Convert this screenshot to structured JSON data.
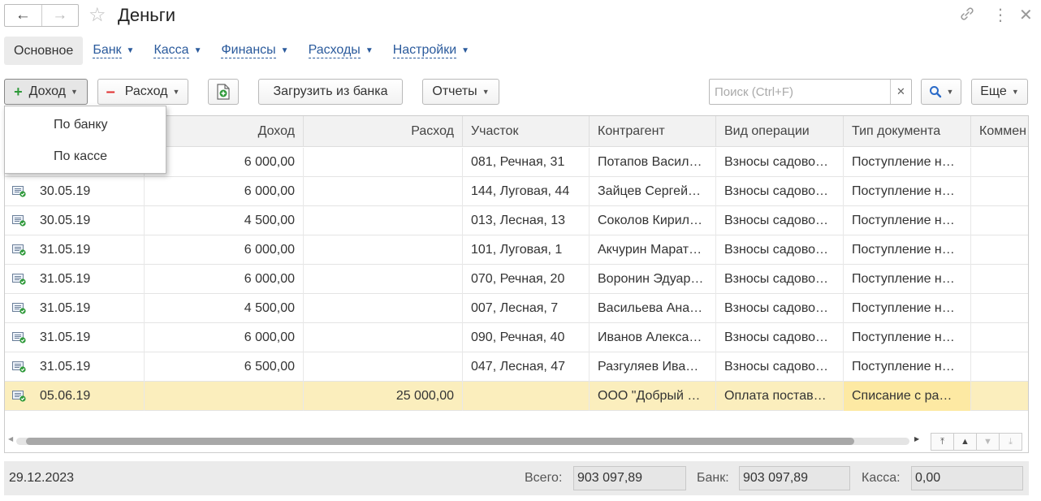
{
  "window": {
    "title": "Деньги"
  },
  "tabs": [
    {
      "label": "Основное",
      "active": true
    },
    {
      "label": "Банк",
      "dropdown": true
    },
    {
      "label": "Касса",
      "dropdown": true
    },
    {
      "label": "Финансы",
      "dropdown": true
    },
    {
      "label": "Расходы",
      "dropdown": true
    },
    {
      "label": "Настройки",
      "dropdown": true
    }
  ],
  "toolbar": {
    "income_label": "Доход",
    "expense_label": "Расход",
    "load_bank_label": "Загрузить из банка",
    "reports_label": "Отчеты",
    "more_label": "Еще"
  },
  "search": {
    "placeholder": "Поиск (Ctrl+F)",
    "value": ""
  },
  "income_menu": {
    "items": [
      "По банку",
      "По кассе"
    ]
  },
  "table": {
    "columns": [
      "Доход",
      "Расход",
      "Участок",
      "Контрагент",
      "Вид операции",
      "Тип документа",
      "Коммен"
    ],
    "rows": [
      {
        "date": "",
        "income": "6 000,00",
        "expense": "",
        "plot": "081, Речная, 31",
        "counterparty": "Потапов Васил…",
        "operation": "Взносы садово…",
        "doc_type": "Поступление н…",
        "comment": ""
      },
      {
        "date": "30.05.19",
        "income": "6 000,00",
        "expense": "",
        "plot": "144, Луговая, 44",
        "counterparty": "Зайцев Сергей…",
        "operation": "Взносы садово…",
        "doc_type": "Поступление н…",
        "comment": ""
      },
      {
        "date": "30.05.19",
        "income": "4 500,00",
        "expense": "",
        "plot": "013, Лесная, 13",
        "counterparty": "Соколов Кирил…",
        "operation": "Взносы садово…",
        "doc_type": "Поступление н…",
        "comment": ""
      },
      {
        "date": "31.05.19",
        "income": "6 000,00",
        "expense": "",
        "plot": "101, Луговая, 1",
        "counterparty": "Акчурин Марат…",
        "operation": "Взносы садово…",
        "doc_type": "Поступление н…",
        "comment": ""
      },
      {
        "date": "31.05.19",
        "income": "6 000,00",
        "expense": "",
        "plot": "070, Речная, 20",
        "counterparty": "Воронин Эдуар…",
        "operation": "Взносы садово…",
        "doc_type": "Поступление н…",
        "comment": ""
      },
      {
        "date": "31.05.19",
        "income": "4 500,00",
        "expense": "",
        "plot": "007, Лесная, 7",
        "counterparty": "Васильева Ана…",
        "operation": "Взносы садово…",
        "doc_type": "Поступление н…",
        "comment": ""
      },
      {
        "date": "31.05.19",
        "income": "6 000,00",
        "expense": "",
        "plot": "090, Речная, 40",
        "counterparty": "Иванов Алекса…",
        "operation": "Взносы садово…",
        "doc_type": "Поступление н…",
        "comment": ""
      },
      {
        "date": "31.05.19",
        "income": "6 500,00",
        "expense": "",
        "plot": "047, Лесная, 47",
        "counterparty": "Разгуляев Ива…",
        "operation": "Взносы садово…",
        "doc_type": "Поступление н…",
        "comment": ""
      },
      {
        "date": "05.06.19",
        "income": "",
        "expense": "25 000,00",
        "plot": "",
        "counterparty": "ООО \"Добрый …",
        "operation": "Оплата постав…",
        "doc_type": "Списание с ра…",
        "comment": "",
        "selected": true
      }
    ]
  },
  "footer": {
    "date": "29.12.2023",
    "total_label": "Всего:",
    "total_value": "903 097,89",
    "bank_label": "Банк:",
    "bank_value": "903 097,89",
    "cash_label": "Касса:",
    "cash_value": "0,00"
  },
  "colors": {
    "link": "#2a5a9c",
    "selected_row": "#fbeebd",
    "income_plus": "#2f9a3a",
    "expense_minus": "#e03030"
  }
}
